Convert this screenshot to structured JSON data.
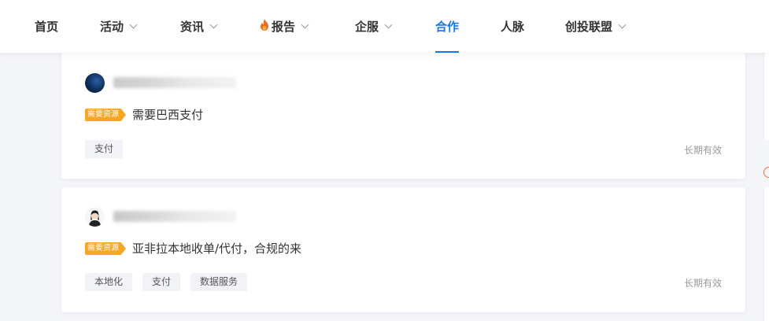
{
  "nav": {
    "items": [
      {
        "label": "首页",
        "dropdown": false
      },
      {
        "label": "活动",
        "dropdown": true
      },
      {
        "label": "资讯",
        "dropdown": true
      },
      {
        "label": "报告",
        "dropdown": true,
        "icon": "fire-icon"
      },
      {
        "label": "企服",
        "dropdown": true
      },
      {
        "label": "合作",
        "dropdown": false,
        "active": true
      },
      {
        "label": "人脉",
        "dropdown": false
      },
      {
        "label": "创投联盟",
        "dropdown": true
      }
    ],
    "accent_color": "#1677e6"
  },
  "posts": [
    {
      "tag": "需要资源",
      "title": "需要巴西支付",
      "chips": [
        "支付"
      ],
      "validity": "长期有效"
    },
    {
      "tag": "需要资源",
      "title": "亚非拉本地收单/代付，合规的来",
      "chips": [
        "本地化",
        "支付",
        "数据服务"
      ],
      "validity": "长期有效"
    }
  ],
  "colors": {
    "demand_tag": "#f5a623",
    "background": "#f4f5f9"
  }
}
